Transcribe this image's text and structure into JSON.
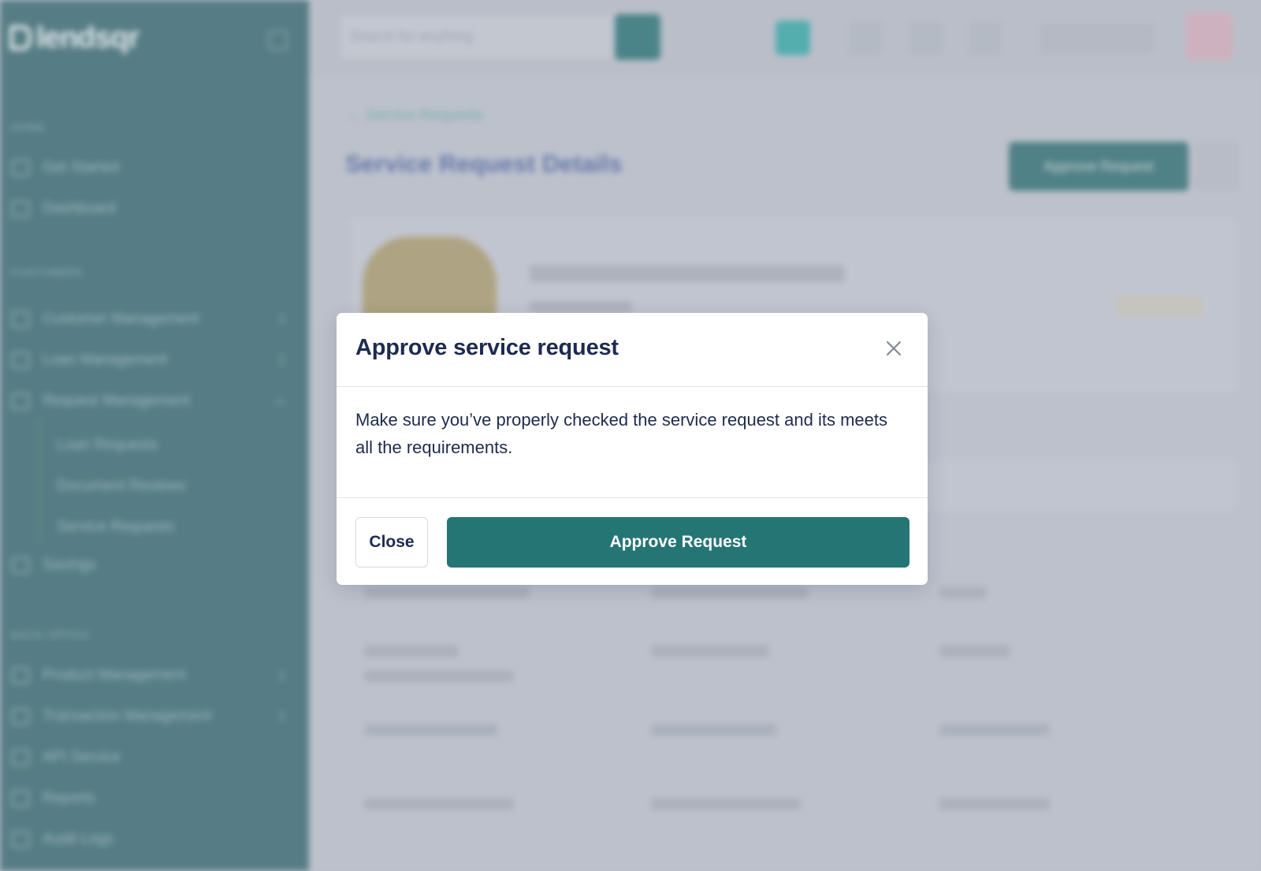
{
  "app": {
    "logo_text": "lendsqr"
  },
  "sidebar": {
    "sections": [
      {
        "label": "HOME"
      },
      {
        "label": "CUSTOMERS"
      },
      {
        "label": "BACK OFFICE"
      }
    ],
    "items": [
      {
        "label": "Get Started"
      },
      {
        "label": "Dashboard"
      },
      {
        "label": "Customer Management"
      },
      {
        "label": "Loan Management"
      },
      {
        "label": "Request Management"
      },
      {
        "label": "Savings"
      },
      {
        "label": "Product Management"
      },
      {
        "label": "Transaction Management"
      },
      {
        "label": "API Service"
      },
      {
        "label": "Reports"
      },
      {
        "label": "Audit Logs"
      }
    ],
    "sub_items": [
      {
        "label": "Loan Requests"
      },
      {
        "label": "Document Reviews"
      },
      {
        "label": "Service Requests"
      }
    ]
  },
  "topbar": {
    "search_placeholder": "Search for anything"
  },
  "page": {
    "breadcrumb": "Service Requests",
    "title": "Service Request Details",
    "approve_label": "Approve Request"
  },
  "modal": {
    "title": "Approve service request",
    "body": "Make sure you’ve properly checked the service request and its meets all the requirements.",
    "close_label": "Close",
    "approve_label": "Approve Request"
  },
  "colors": {
    "primary": "#267575",
    "heading_text": "#1d2b4f",
    "sidebar_bg": "#5a8289"
  }
}
